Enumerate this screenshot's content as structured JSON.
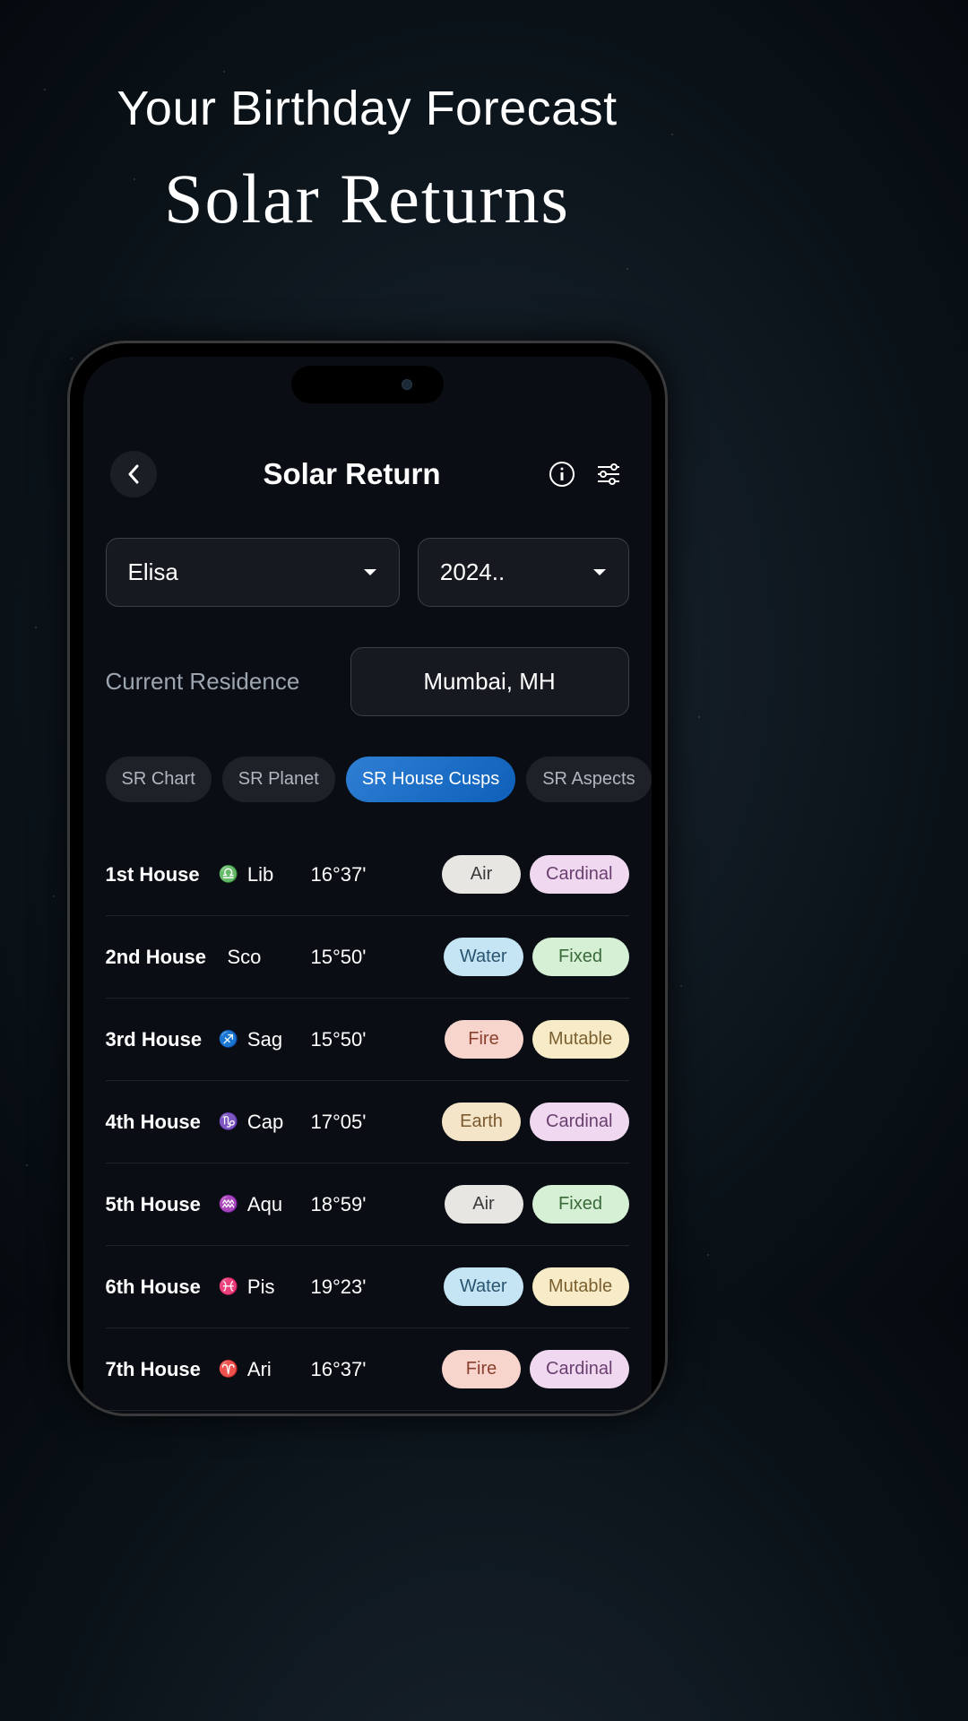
{
  "hero": {
    "title": "Your Birthday Forecast",
    "subtitle": "Solar Returns"
  },
  "header": {
    "page_title": "Solar Return"
  },
  "selectors": {
    "name": "Elisa",
    "year": "2024.."
  },
  "residence": {
    "label": "Current Residence",
    "value": "Mumbai, MH"
  },
  "tabs": [
    {
      "label": "SR Chart",
      "active": false
    },
    {
      "label": "SR Planet",
      "active": false
    },
    {
      "label": "SR House Cusps",
      "active": true
    },
    {
      "label": "SR Aspects",
      "active": false
    }
  ],
  "houses": [
    {
      "name": "1st House",
      "sign_icon": "♎",
      "sign": "Lib",
      "degree": "16°37'",
      "element": "Air",
      "modality": "Cardinal",
      "icon_color": ""
    },
    {
      "name": "2nd House",
      "sign_icon": "",
      "sign": "Sco",
      "degree": "15°50'",
      "element": "Water",
      "modality": "Fixed",
      "icon_color": ""
    },
    {
      "name": "3rd House",
      "sign_icon": "♐",
      "sign": "Sag",
      "degree": "15°50'",
      "element": "Fire",
      "modality": "Mutable",
      "icon_color": "blue"
    },
    {
      "name": "4th House",
      "sign_icon": "♑",
      "sign": "Cap",
      "degree": "17°05'",
      "element": "Earth",
      "modality": "Cardinal",
      "icon_color": ""
    },
    {
      "name": "5th House",
      "sign_icon": "♒",
      "sign": "Aqu",
      "degree": "18°59'",
      "element": "Air",
      "modality": "Fixed",
      "icon_color": "purple"
    },
    {
      "name": "6th House",
      "sign_icon": "♓",
      "sign": "Pis",
      "degree": "19°23'",
      "element": "Water",
      "modality": "Mutable",
      "icon_color": ""
    },
    {
      "name": "7th House",
      "sign_icon": "♈",
      "sign": "Ari",
      "degree": "16°37'",
      "element": "Fire",
      "modality": "Cardinal",
      "icon_color": ""
    }
  ]
}
